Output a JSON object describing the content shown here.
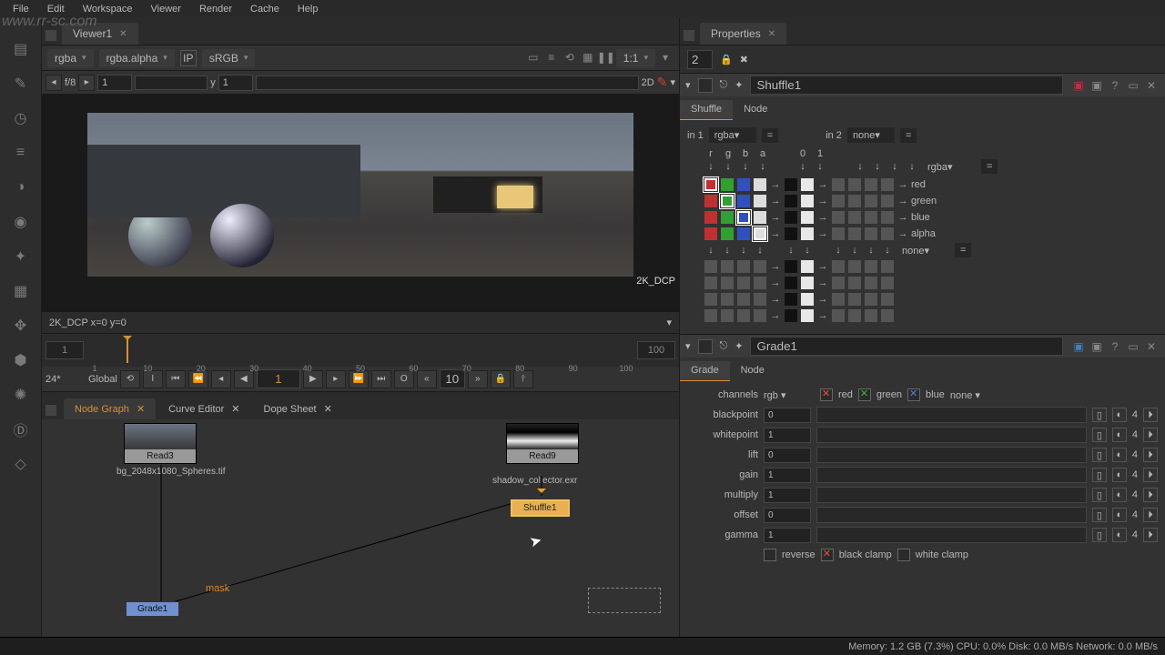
{
  "menu": {
    "items": [
      "File",
      "Edit",
      "Workspace",
      "Viewer",
      "Render",
      "Cache",
      "Help"
    ]
  },
  "watermark": "www.rr-sc.com",
  "viewer": {
    "tab": "Viewer1",
    "channel": "rgba",
    "layer": "rgba.alpha",
    "ip": "IP",
    "lut": "sRGB",
    "zoom": "1:1",
    "f": "f/8",
    "frame": "1",
    "y": "y",
    "yv": "1",
    "view2d": "2D",
    "info": "2K_DCP  x=0  y=0",
    "format": "2K_DCP"
  },
  "timeline": {
    "start": "1",
    "end": "100",
    "cur": "1",
    "ticks": [
      "1",
      "10",
      "20",
      "30",
      "40",
      "50",
      "60",
      "70",
      "80",
      "90",
      "100"
    ],
    "fps": "24*",
    "mode": "Global",
    "step": "10"
  },
  "btabs": {
    "a": "Node Graph",
    "b": "Curve Editor",
    "c": "Dope Sheet"
  },
  "nodes": {
    "read3": "Read3",
    "read3file": "bg_2048x1080_Spheres.tif",
    "read9": "Read9",
    "read9file": "shadow_collector.exr",
    "shuffle": "Shuffle1",
    "grade": "Grade1",
    "mask": "mask"
  },
  "props": {
    "title": "Properties",
    "count": "2",
    "shuffle": {
      "name": "Shuffle1",
      "t1": "Shuffle",
      "t2": "Node",
      "in1": "in 1",
      "in1v": "rgba",
      "in2": "in 2",
      "in2v": "none",
      "cols": [
        "r",
        "g",
        "b",
        "a",
        "0",
        "1"
      ],
      "outdd1": "rgba",
      "outdd2": "none",
      "outs": [
        "red",
        "green",
        "blue",
        "alpha"
      ]
    },
    "grade": {
      "name": "Grade1",
      "t1": "Grade",
      "t2": "Node",
      "channels": "channels",
      "chv": "rgb",
      "red": "red",
      "green": "green",
      "blue": "blue",
      "mask": "none",
      "params": [
        {
          "l": "blackpoint",
          "v": "0"
        },
        {
          "l": "whitepoint",
          "v": "1"
        },
        {
          "l": "lift",
          "v": "0"
        },
        {
          "l": "gain",
          "v": "1"
        },
        {
          "l": "multiply",
          "v": "1"
        },
        {
          "l": "offset",
          "v": "0"
        },
        {
          "l": "gamma",
          "v": "1"
        }
      ],
      "reverse": "reverse",
      "bclamp": "black clamp",
      "wclamp": "white clamp",
      "four": "4"
    }
  },
  "status": "Memory: 1.2 GB (7.3%)  CPU: 0.0%  Disk: 0.0 MB/s  Network: 0.0 MB/s"
}
